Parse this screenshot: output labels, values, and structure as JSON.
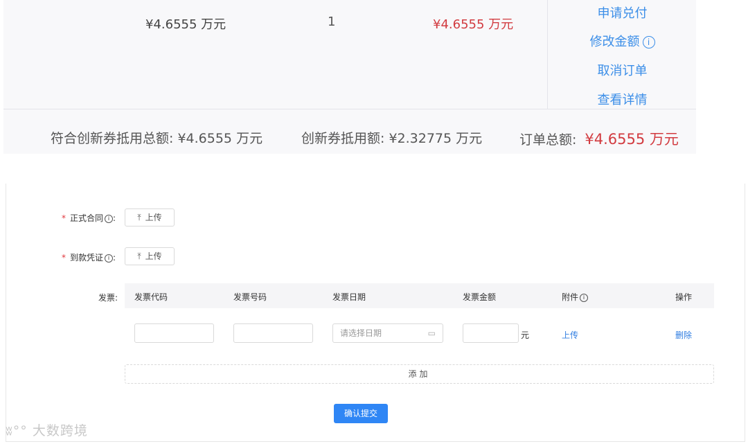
{
  "order": {
    "unit_price": "¥4.6555 万元",
    "quantity": "1",
    "subtotal": "¥4.6555 万元",
    "actions": [
      "申请兑付",
      "修改金额",
      "取消订单",
      "查看详情"
    ]
  },
  "summary": {
    "eligible_label": "符合创新券抵用总额:",
    "eligible_value": "¥4.6555 万元",
    "voucher_label": "创新券抵用额:",
    "voucher_value": "¥2.32775 万元",
    "total_label": "订单总额:",
    "total_value": "¥4.6555 万元"
  },
  "form": {
    "contract_label": "正式合同",
    "receipt_label": "到款凭证",
    "upload_label": "上传",
    "invoice_label": "发票:",
    "columns": [
      "发票代码",
      "发票号码",
      "发票日期",
      "发票金额",
      "附件",
      "操作"
    ],
    "date_placeholder": "请选择日期",
    "amount_unit": "元",
    "row_upload": "上传",
    "row_delete": "删除",
    "add_label": "添加",
    "submit_label": "确认提交"
  },
  "watermark": "大数跨境",
  "colors": {
    "accent": "#2f86f5",
    "price_red": "#d23b40",
    "link": "#3b8ee8"
  }
}
